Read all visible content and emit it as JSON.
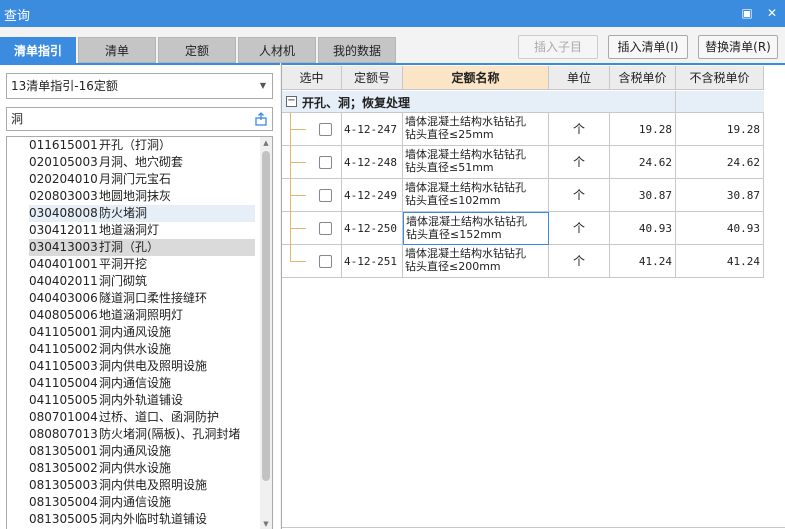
{
  "window": {
    "title": "查询",
    "maximize_glyph": "▣",
    "close_glyph": "✕"
  },
  "tabs": [
    {
      "label": "清单指引",
      "active": true
    },
    {
      "label": "清单",
      "active": false
    },
    {
      "label": "定额",
      "active": false
    },
    {
      "label": "人材机",
      "active": false
    },
    {
      "label": "我的数据",
      "active": false
    }
  ],
  "toolbar": {
    "insert_child_label": "插入子目",
    "insert_list_label": "插入清单(I)",
    "replace_list_label": "替换清单(R)"
  },
  "left": {
    "select_value": "13清单指引-16定额",
    "search_value": "洞",
    "items": [
      {
        "code": "011615001",
        "name": "开孔（打洞）"
      },
      {
        "code": "020105003",
        "name": "月洞、地穴砌套"
      },
      {
        "code": "020204010",
        "name": "月洞门元宝石"
      },
      {
        "code": "020803003",
        "name": "地圆地洞抹灰"
      },
      {
        "code": "030408008",
        "name": "防火堵洞"
      },
      {
        "code": "030412011",
        "name": "地道涵洞灯"
      },
      {
        "code": "030413003",
        "name": "打洞（孔）"
      },
      {
        "code": "040401001",
        "name": "平洞开挖"
      },
      {
        "code": "040402011",
        "name": "洞门砌筑"
      },
      {
        "code": "040403006",
        "name": "隧道洞口柔性接缝环"
      },
      {
        "code": "040805006",
        "name": "地道涵洞照明灯"
      },
      {
        "code": "041105001",
        "name": "洞内通风设施"
      },
      {
        "code": "041105002",
        "name": "洞内供水设施"
      },
      {
        "code": "041105003",
        "name": "洞内供电及照明设施"
      },
      {
        "code": "041105004",
        "name": "洞内通信设施"
      },
      {
        "code": "041105005",
        "name": "洞内外轨道铺设"
      },
      {
        "code": "080701004",
        "name": "过桥、道口、函洞防护"
      },
      {
        "code": "080807013",
        "name": "防火堵洞(隔板)、孔洞封堵"
      },
      {
        "code": "081305001",
        "name": "洞内通风设施"
      },
      {
        "code": "081305002",
        "name": "洞内供水设施"
      },
      {
        "code": "081305003",
        "name": "洞内供电及照明设施"
      },
      {
        "code": "081305004",
        "name": "洞内通信设施"
      },
      {
        "code": "081305005",
        "name": "洞内外临时轨道铺设"
      }
    ]
  },
  "grid": {
    "headers": [
      "选中",
      "定额号",
      "定额名称",
      "单位",
      "含税单价",
      "不含税单价"
    ],
    "group_title": "开孔、洞；恢复处理",
    "rows": [
      {
        "code": "4-12-247",
        "name1": "墙体混凝土结构水钻钻孔",
        "name2": "钻头直径≤25mm",
        "unit": "个",
        "price_tax": "19.28",
        "price_notax": "19.28"
      },
      {
        "code": "4-12-248",
        "name1": "墙体混凝土结构水钻钻孔",
        "name2": "钻头直径≤51mm",
        "unit": "个",
        "price_tax": "24.62",
        "price_notax": "24.62"
      },
      {
        "code": "4-12-249",
        "name1": "墙体混凝土结构水钻钻孔",
        "name2": "钻头直径≤102mm",
        "unit": "个",
        "price_tax": "30.87",
        "price_notax": "30.87"
      },
      {
        "code": "4-12-250",
        "name1": "墙体混凝土结构水钻钻孔",
        "name2": "钻头直径≤152mm",
        "unit": "个",
        "price_tax": "40.93",
        "price_notax": "40.93"
      },
      {
        "code": "4-12-251",
        "name1": "墙体混凝土结构水钻钻孔",
        "name2": "钻头直径≤200mm",
        "unit": "个",
        "price_tax": "41.24",
        "price_notax": "41.24"
      }
    ]
  }
}
